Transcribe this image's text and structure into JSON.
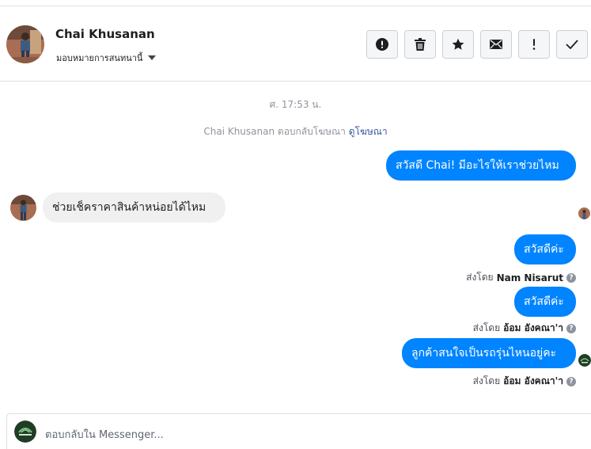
{
  "header": {
    "name": "Chai Khusanan",
    "assign_label": "มอบหมายการสนทนานี้",
    "actions": [
      {
        "name": "spam-button",
        "icon": "exclamation-circle-icon"
      },
      {
        "name": "delete-button",
        "icon": "trash-icon"
      },
      {
        "name": "star-button",
        "icon": "star-icon"
      },
      {
        "name": "mark-unread-button",
        "icon": "envelope-icon"
      },
      {
        "name": "follow-up-button",
        "icon": "exclamation-icon"
      },
      {
        "name": "mark-done-button",
        "icon": "checkmark-icon"
      }
    ]
  },
  "thread": {
    "timestamp": "ศ. 17:53 น.",
    "reply_note_text": "Chai Khusanan ตอบกลับโฆษณา",
    "reply_note_link": "ดูโฆษณา",
    "messages": [
      {
        "direction": "outgoing",
        "text": "สวัสดี Chai! มีอะไรให้เราช่วยไหม"
      },
      {
        "direction": "incoming",
        "text": "ช่วยเช็คราคาสินค้าหน่อยได้ไหม"
      },
      {
        "direction": "outgoing",
        "text": "สวัสดีค่ะ",
        "sent_by_label": "ส่งโดย",
        "sender": "Nam Nisarut"
      },
      {
        "direction": "outgoing",
        "text": "สวัสดีค่ะ",
        "sent_by_label": "ส่งโดย",
        "sender": "อ้อม อังคณา'า"
      },
      {
        "direction": "outgoing",
        "text": "ลูกค้าสนใจเป็นรถรุ่นไหนอยู่คะ",
        "sent_by_label": "ส่งโดย",
        "sender": "อ้อม อังคณา'า"
      }
    ]
  },
  "composer": {
    "placeholder": "ตอบกลับใน Messenger..."
  },
  "colors": {
    "outgoing_bubble": "#0084ff",
    "incoming_bubble": "#f1f0f0",
    "link": "#385898"
  }
}
